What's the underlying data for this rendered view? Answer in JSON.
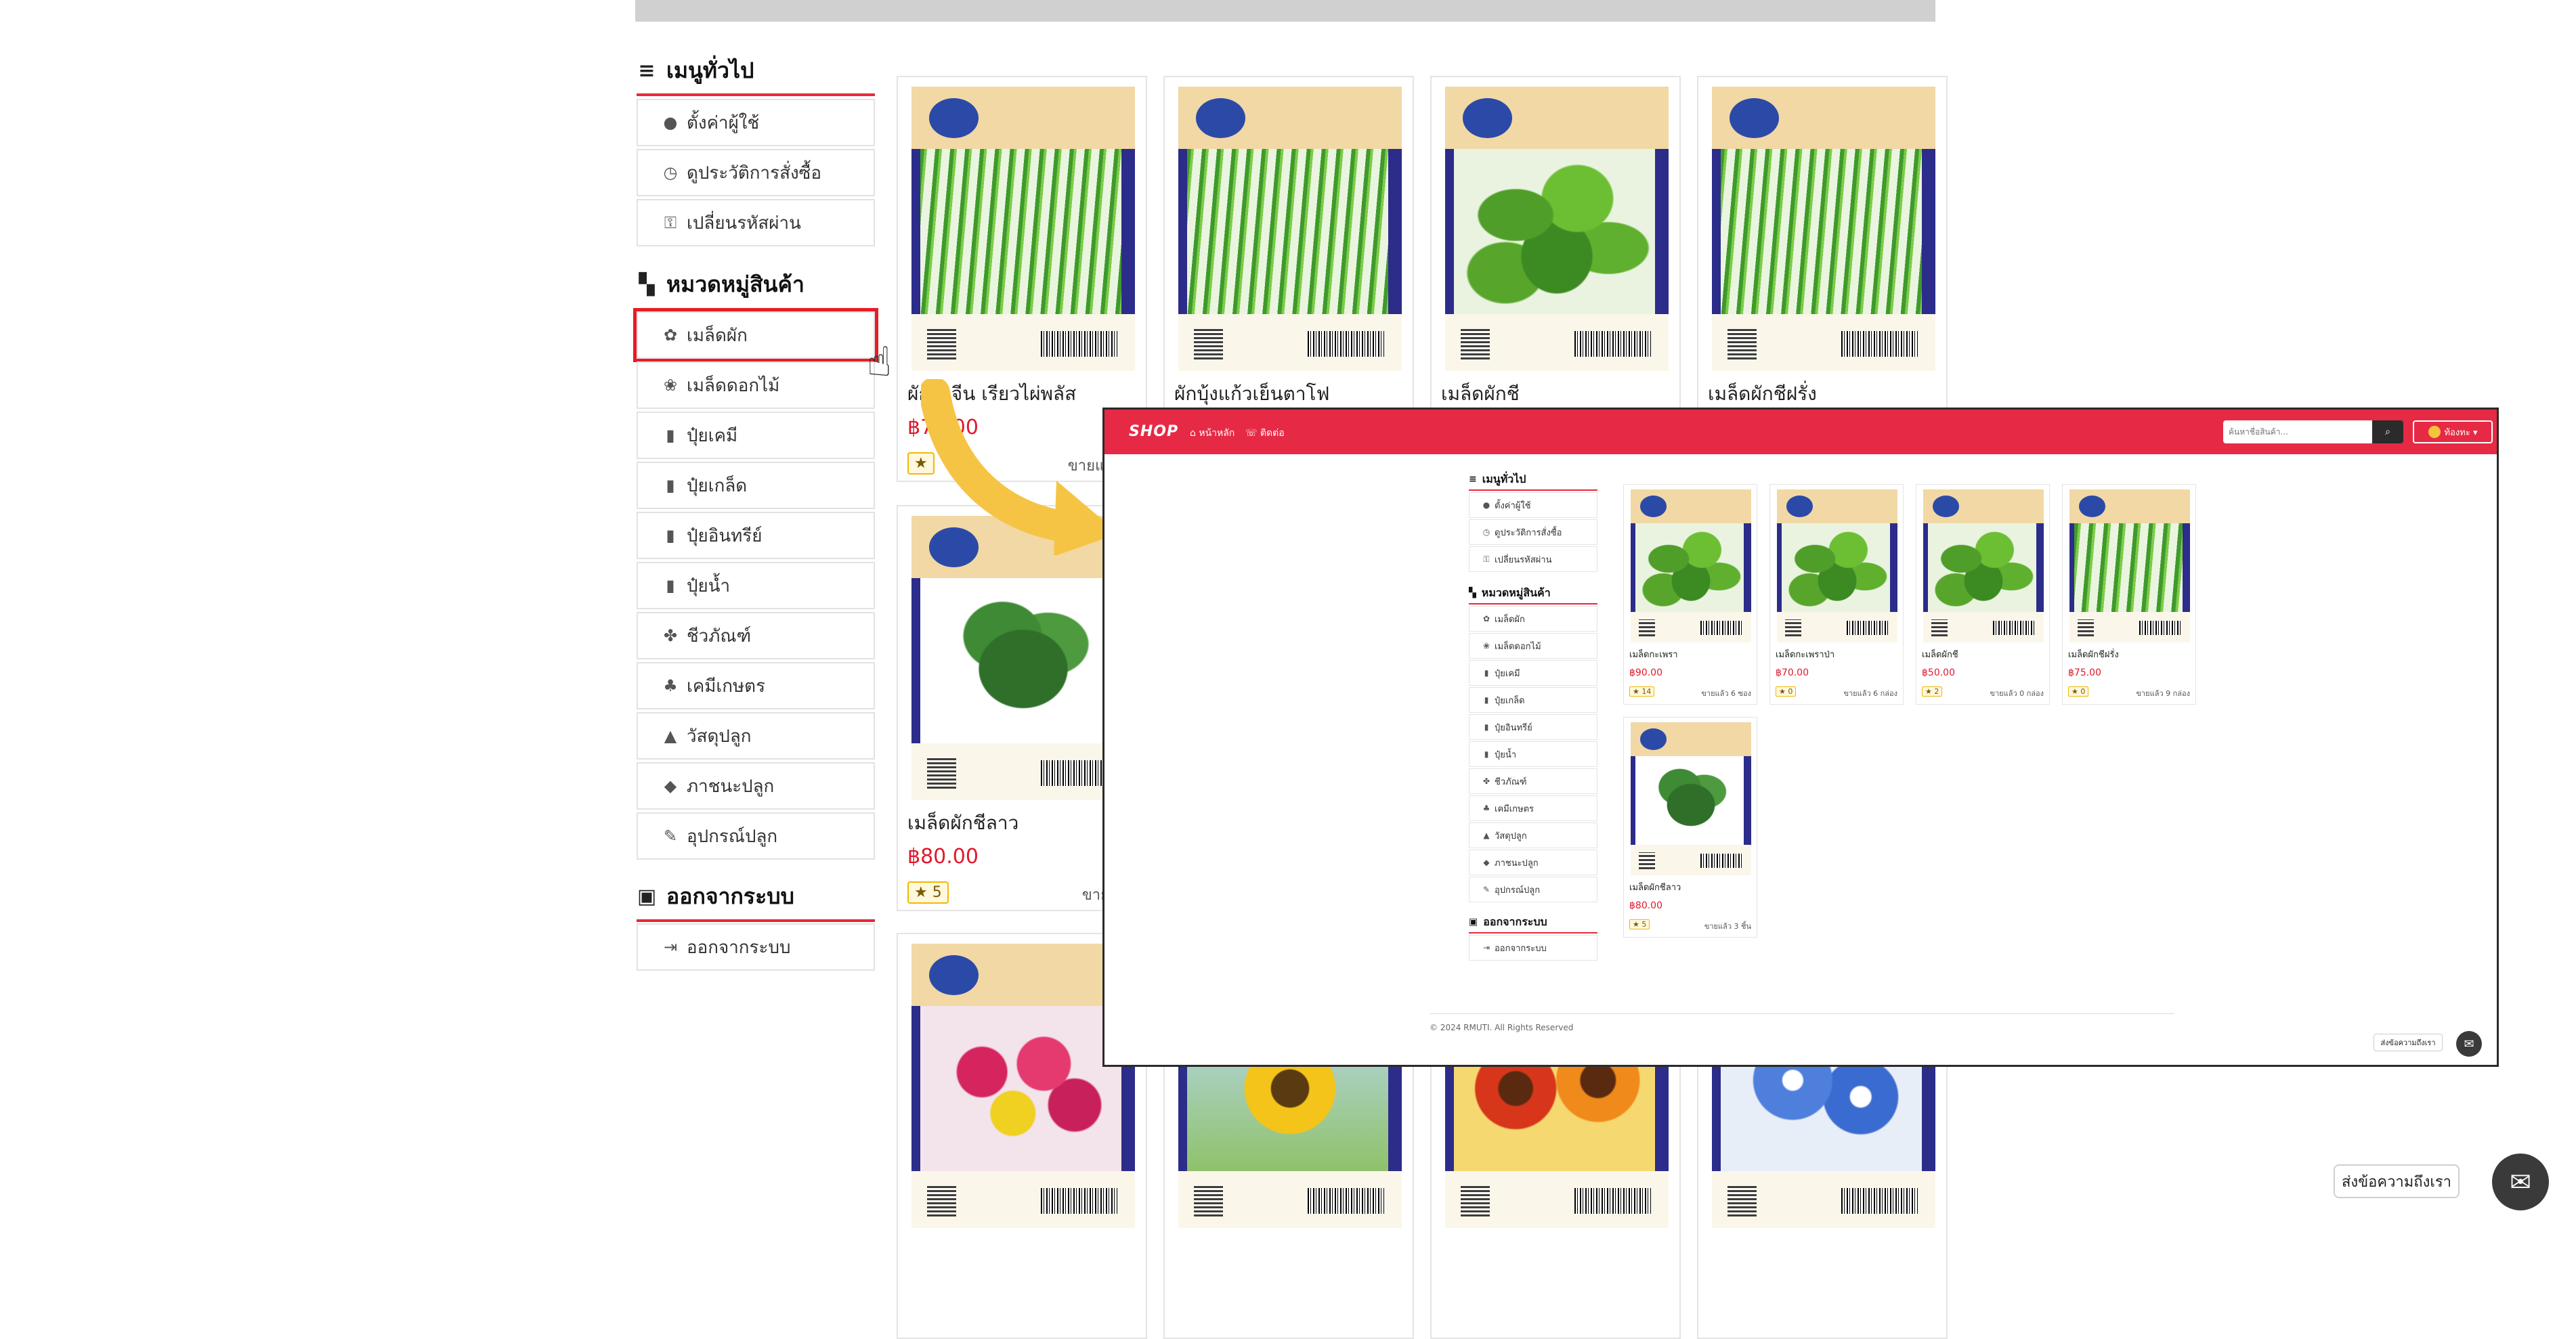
{
  "sidebar": {
    "general_title": "เมนูทั่วไป",
    "general_items": [
      {
        "label": "ตั้งค่าผู้ใช้",
        "icon": "user-circle-icon",
        "glyph": "●"
      },
      {
        "label": "ดูประวัติการสั่งซื้อ",
        "icon": "history-icon",
        "glyph": "◷"
      },
      {
        "label": "เปลี่ยนรหัสผ่าน",
        "icon": "key-icon",
        "glyph": "⚿"
      }
    ],
    "category_title": "หมวดหมู่สินค้า",
    "category_items": [
      {
        "label": "เมล็ดผัก",
        "icon": "seeds-icon",
        "glyph": "✿"
      },
      {
        "label": "เมล็ดดอกไม้",
        "icon": "flower-icon",
        "glyph": "❀"
      },
      {
        "label": "ปุ๋ยเคมี",
        "icon": "chemical-fertilizer-icon",
        "glyph": "▮"
      },
      {
        "label": "ปุ๋ยเกล็ด",
        "icon": "flake-fertilizer-icon",
        "glyph": "▮"
      },
      {
        "label": "ปุ๋ยอินทรีย์",
        "icon": "organic-fertilizer-icon",
        "glyph": "▮"
      },
      {
        "label": "ปุ๋ยน้ำ",
        "icon": "liquid-fertilizer-icon",
        "glyph": "▮"
      },
      {
        "label": "ชีวภัณฑ์",
        "icon": "bio-product-icon",
        "glyph": "✤"
      },
      {
        "label": "เคมีเกษตร",
        "icon": "agrochemical-icon",
        "glyph": "♣"
      },
      {
        "label": "วัสดุปลูก",
        "icon": "soil-icon",
        "glyph": "▲"
      },
      {
        "label": "ภาชนะปลูก",
        "icon": "pot-icon",
        "glyph": "◆"
      },
      {
        "label": "อุปกรณ์ปลูก",
        "icon": "garden-tool-icon",
        "glyph": "✎"
      }
    ],
    "logout_title": "ออกจากระบบ",
    "logout_item": {
      "label": "ออกจากระบบ",
      "icon": "logout-icon",
      "glyph": "⇥"
    }
  },
  "background_products": [
    {
      "name": "ผักบุ้งจีน เรียวไผ่พลัส",
      "price": "฿70.00",
      "rating": "★",
      "sold": "ขายแล้ว 1",
      "art": "stalky"
    },
    {
      "name": "ผักบุ้งแก้วเย็นตาโฟ",
      "price": "",
      "rating": "",
      "sold": "",
      "art": "stalky"
    },
    {
      "name": "เมล็ดผักชี",
      "price": "",
      "rating": "",
      "sold": "",
      "art": "leafy"
    },
    {
      "name": "เมล็ดผักชีฝรั่ง",
      "price": "",
      "rating": "",
      "sold": "",
      "art": "stalky"
    },
    {
      "name": "เมล็ดผักชีลาว",
      "price": "฿80.00",
      "rating": "★ 5",
      "sold": "ขายแล้ว",
      "art": "dill"
    },
    {
      "name": "",
      "price": "",
      "rating": "",
      "sold": "",
      "art": "flowerpink"
    },
    {
      "name": "",
      "price": "",
      "rating": "",
      "sold": "",
      "art": "sunflower"
    },
    {
      "name": "",
      "price": "",
      "rating": "",
      "sold": "",
      "art": "sunflower2"
    },
    {
      "name": "",
      "price": "",
      "rating": "",
      "sold": "",
      "art": "morning"
    }
  ],
  "overlay": {
    "logo": "SHOP",
    "nav": {
      "home": "⌂ หน้าหลัก",
      "contact": "☏ ติดต่อ"
    },
    "search_placeholder": "ค้นหาชื่อสินค้า...",
    "search_icon": "search-icon",
    "user_label": "ท้องทะ ▾",
    "products": [
      {
        "name": "เมล็ดกะเพรา",
        "price": "฿90.00",
        "rating": "★ 14",
        "sold": "ขายแล้ว 6 ซอง",
        "art": "leafy"
      },
      {
        "name": "เมล็ดกะเพราป่า",
        "price": "฿70.00",
        "rating": "★ 0",
        "sold": "ขายแล้ว 6 กล่อง",
        "art": "leafy"
      },
      {
        "name": "เมล็ดผักชี",
        "price": "฿50.00",
        "rating": "★ 2",
        "sold": "ขายแล้ว 0 กล่อง",
        "art": "leafy"
      },
      {
        "name": "เมล็ดผักชีฝรั่ง",
        "price": "฿75.00",
        "rating": "★ 0",
        "sold": "ขายแล้ว 9 กล่อง",
        "art": "stalky"
      },
      {
        "name": "เมล็ดผักชีลาว",
        "price": "฿80.00",
        "rating": "★ 5",
        "sold": "ขายแล้ว 3 ชิ้น",
        "art": "dill"
      }
    ],
    "footer": "© 2024 RMUTI. All Rights Reserved",
    "contact_label": "ส่งข้อความถึงเรา",
    "chat_icon": "chat-icon"
  },
  "chat": {
    "label": "ส่งข้อความถึงเรา",
    "icon": "chat-bubble-icon"
  },
  "colors": {
    "brand_red": "#e62a45",
    "price_red": "#e0192c",
    "highlight_box": "#e81c24",
    "arrow_yellow": "#f6c445"
  }
}
